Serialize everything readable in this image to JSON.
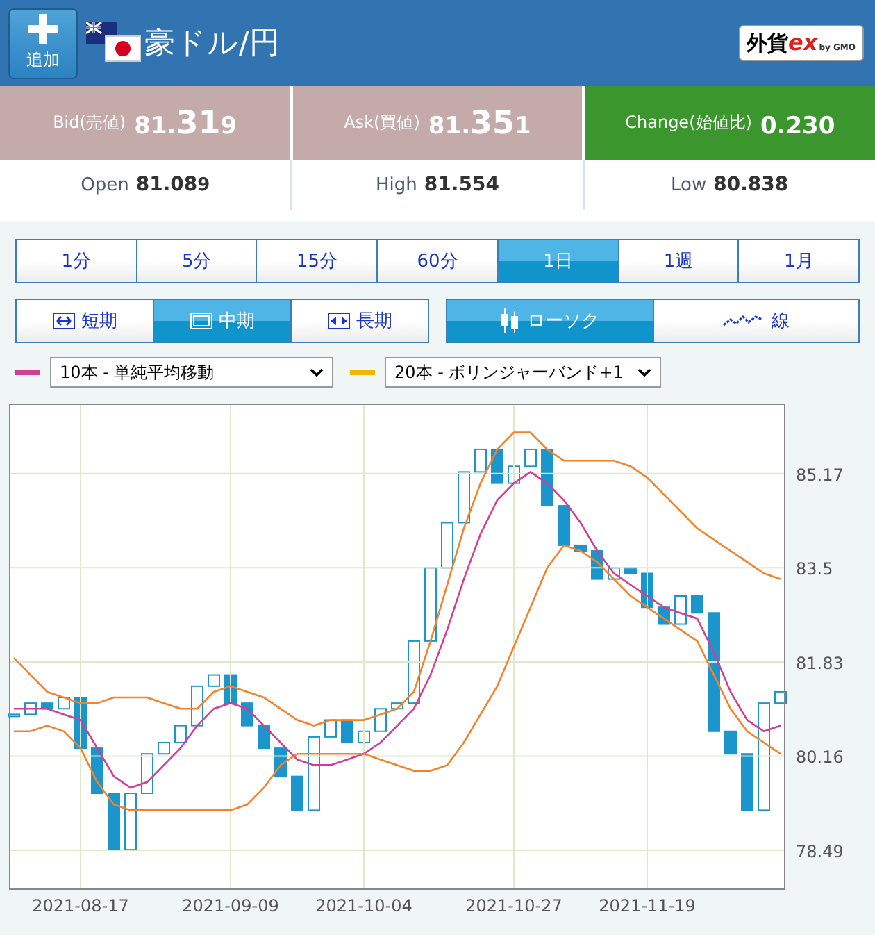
{
  "header": {
    "add_button": "追加",
    "title": "豪ドル/円",
    "logo": {
      "main": "外貨",
      "accent": "ex",
      "by": "by GMO"
    }
  },
  "quotes": [
    {
      "kind": "bid",
      "label": "Bid(売値)",
      "lead": "81.",
      "big": "31",
      "tail": "9"
    },
    {
      "kind": "ask",
      "label": "Ask(買値)",
      "lead": "81.",
      "big": "35",
      "tail": "1"
    },
    {
      "kind": "change",
      "label": "Change(始値比)",
      "lead": "0.230"
    }
  ],
  "ohlc": [
    {
      "label": "Open",
      "lead": "81.08",
      "tail": "9"
    },
    {
      "label": "High",
      "lead": "81.554"
    },
    {
      "label": "Low",
      "lead": "80.838"
    }
  ],
  "periods": [
    {
      "label": "1分",
      "selected": false
    },
    {
      "label": "5分",
      "selected": false
    },
    {
      "label": "15分",
      "selected": false
    },
    {
      "label": "60分",
      "selected": false
    },
    {
      "label": "1日",
      "selected": true
    },
    {
      "label": "1週",
      "selected": false
    },
    {
      "label": "1月",
      "selected": false
    }
  ],
  "ranges": [
    {
      "kind": "short",
      "label": "短期",
      "selected": false
    },
    {
      "kind": "mid",
      "label": "中期",
      "selected": true
    },
    {
      "kind": "long",
      "label": "長期",
      "selected": false
    }
  ],
  "chart_types": [
    {
      "kind": "candle",
      "label": "ローソク",
      "selected": true
    },
    {
      "kind": "line",
      "label": "線",
      "selected": false
    }
  ],
  "indicators": [
    {
      "color": "#d63c96",
      "value": "10本 - 単純平均移動"
    },
    {
      "color": "#f5b400",
      "value": "20本 - ボリンジャーバンド+1"
    }
  ],
  "chart_data": {
    "type": "line",
    "categories": [
      null,
      null,
      null,
      null,
      "2021-08-17",
      null,
      null,
      null,
      null,
      null,
      null,
      null,
      null,
      "2021-09-09",
      null,
      null,
      null,
      null,
      null,
      null,
      null,
      "2021-10-04",
      null,
      null,
      null,
      null,
      null,
      null,
      null,
      null,
      "2021-10-27",
      null,
      null,
      null,
      null,
      null,
      null,
      null,
      "2021-11-19",
      null,
      null,
      null,
      null,
      null,
      null,
      null,
      null
    ],
    "ylim": [
      77.8,
      86.4
    ],
    "grid": true,
    "yticks": [
      {
        "value": 85.17,
        "label": "85.17"
      },
      {
        "value": 83.5,
        "label": "83.5"
      },
      {
        "value": 81.83,
        "label": "81.83"
      },
      {
        "value": 80.16,
        "label": "80.16"
      },
      {
        "value": 78.49,
        "label": "78.49"
      }
    ],
    "series": [
      {
        "color": "#d63c96",
        "values": [
          81.0,
          81.0,
          81.0,
          80.9,
          80.8,
          80.3,
          79.8,
          79.6,
          79.7,
          80.0,
          80.3,
          80.7,
          81.0,
          81.1,
          81.0,
          80.7,
          80.4,
          80.1,
          80.0,
          80.0,
          80.1,
          80.2,
          80.4,
          80.7,
          81.0,
          81.6,
          82.4,
          83.3,
          84.1,
          84.7,
          85.0,
          85.2,
          85.0,
          84.7,
          84.3,
          83.8,
          83.4,
          83.2,
          83.0,
          82.8,
          82.7,
          82.6,
          82.0,
          81.3,
          80.8,
          80.6,
          80.7
        ]
      },
      {
        "color": "#f5822a",
        "values": [
          81.9,
          81.6,
          81.3,
          81.2,
          81.1,
          81.1,
          81.2,
          81.2,
          81.2,
          81.1,
          81.0,
          81.0,
          81.3,
          81.4,
          81.3,
          81.2,
          81.0,
          80.8,
          80.7,
          80.8,
          80.8,
          80.8,
          80.9,
          81.0,
          81.3,
          82.2,
          83.2,
          84.2,
          85.0,
          85.6,
          85.9,
          85.9,
          85.6,
          85.4,
          85.4,
          85.4,
          85.4,
          85.3,
          85.1,
          84.8,
          84.5,
          84.2,
          84.0,
          83.8,
          83.6,
          83.4,
          83.3
        ]
      },
      {
        "color": "#f5822a",
        "values": [
          80.6,
          80.6,
          80.7,
          80.6,
          80.3,
          79.7,
          79.3,
          79.2,
          79.2,
          79.2,
          79.2,
          79.2,
          79.2,
          79.2,
          79.3,
          79.6,
          80.0,
          80.2,
          80.2,
          80.2,
          80.2,
          80.2,
          80.1,
          80.0,
          79.9,
          79.9,
          80.0,
          80.4,
          80.9,
          81.4,
          82.1,
          82.8,
          83.5,
          83.9,
          83.8,
          83.6,
          83.3,
          83.0,
          82.8,
          82.6,
          82.4,
          82.2,
          81.6,
          81.0,
          80.6,
          80.4,
          80.2
        ]
      }
    ]
  }
}
